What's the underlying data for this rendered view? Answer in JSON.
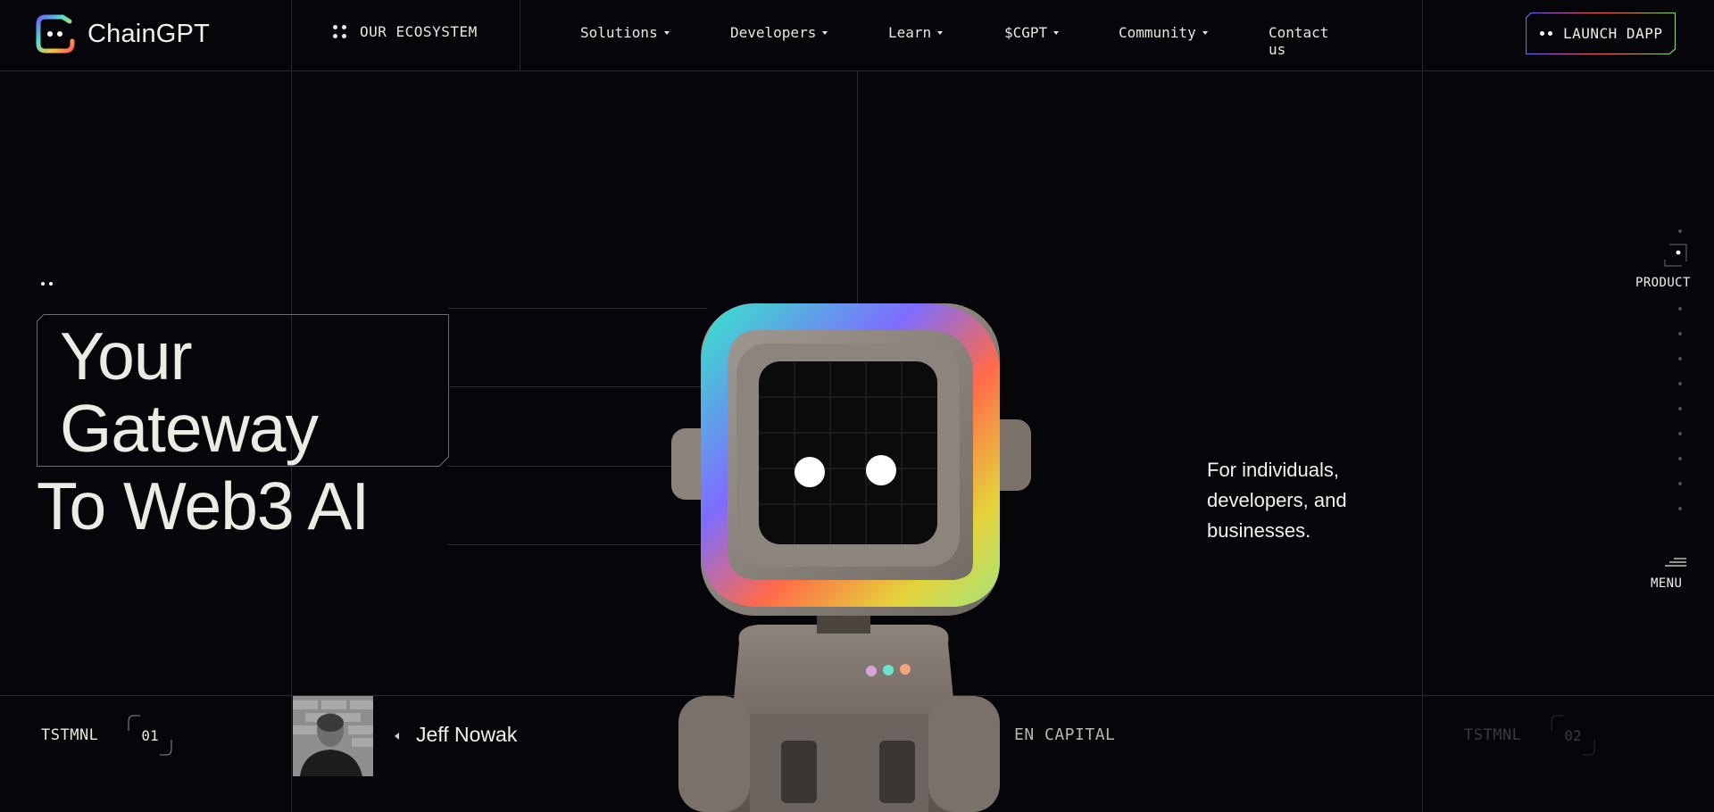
{
  "header": {
    "logo_text": "ChainGPT",
    "ecosystem_label": "OUR ECOSYSTEM",
    "nav": [
      {
        "label": "Solutions",
        "has_dropdown": true
      },
      {
        "label": "Developers",
        "has_dropdown": true
      },
      {
        "label": "Learn",
        "has_dropdown": true
      },
      {
        "label": "$CGPT",
        "has_dropdown": true
      },
      {
        "label": "Community",
        "has_dropdown": true
      },
      {
        "label": "Contact us",
        "has_dropdown": false
      }
    ],
    "launch_label": "LAUNCH DAPP"
  },
  "hero": {
    "line1": "Your",
    "line2": "Gateway",
    "line3": "To Web3 AI",
    "tagline": "For individuals, developers, and businesses."
  },
  "side_nav": {
    "product_label": "PRODUCT",
    "menu_label": "MENU"
  },
  "testimonials": {
    "label_left": "TSTMNL",
    "num_left": "01",
    "person_name": "Jeff Nowak",
    "company_partial": "EN CAPITAL",
    "label_right": "TSTMNL",
    "num_right": "02"
  },
  "colors": {
    "background": "#05050a",
    "grid_line": "#2a2a30",
    "text": "#e9e9e2",
    "gradient": [
      "#ff5c5c",
      "#f5c542",
      "#4ee0c8",
      "#6f5cff"
    ]
  }
}
